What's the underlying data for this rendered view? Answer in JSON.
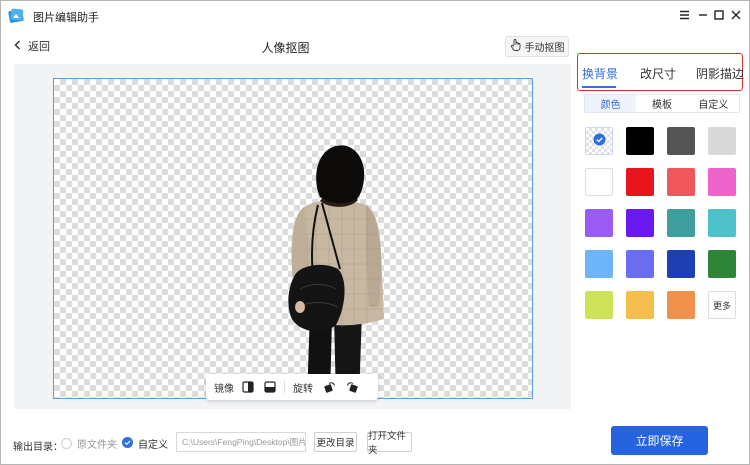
{
  "app": {
    "title": "图片编辑助手"
  },
  "header": {
    "back_label": "返回",
    "page_title": "人像抠图",
    "manual_cutout_label": "手动抠图"
  },
  "toolbar": {
    "mirror_label": "镜像",
    "rotate_label": "旋转"
  },
  "tabs": [
    {
      "label": "换背景",
      "active": true
    },
    {
      "label": "改尺寸",
      "active": false
    },
    {
      "label": "阴影描边",
      "active": false
    }
  ],
  "subtabs": [
    {
      "label": "颜色",
      "active": true
    },
    {
      "label": "模板",
      "active": false
    },
    {
      "label": "自定义",
      "active": false
    }
  ],
  "swatches": [
    "transparent",
    "#000000",
    "#545454",
    "#d9d9d9",
    "#ffffff",
    "#e8141e",
    "#f0575c",
    "#ef64cc",
    "#9a5cf4",
    "#6a19f0",
    "#3f9e9e",
    "#4fc1cb",
    "#6eb4f8",
    "#6b6ef2",
    "#1d3fb3",
    "#2e8437",
    "#cfe35a",
    "#f4be4a",
    "#f0904a"
  ],
  "more_label": "更多",
  "bottom": {
    "output_label": "输出目录：",
    "original_folder_label": "原文件夹",
    "custom_label": "自定义",
    "path_value": "C:\\Users\\FengPing\\Desktop\\图片",
    "change_dir_label": "更改目录",
    "open_folder_label": "打开文件夹",
    "save_label": "立即保存"
  },
  "colors": {
    "accent": "#2563e0",
    "highlight_box": "#d8342e"
  }
}
